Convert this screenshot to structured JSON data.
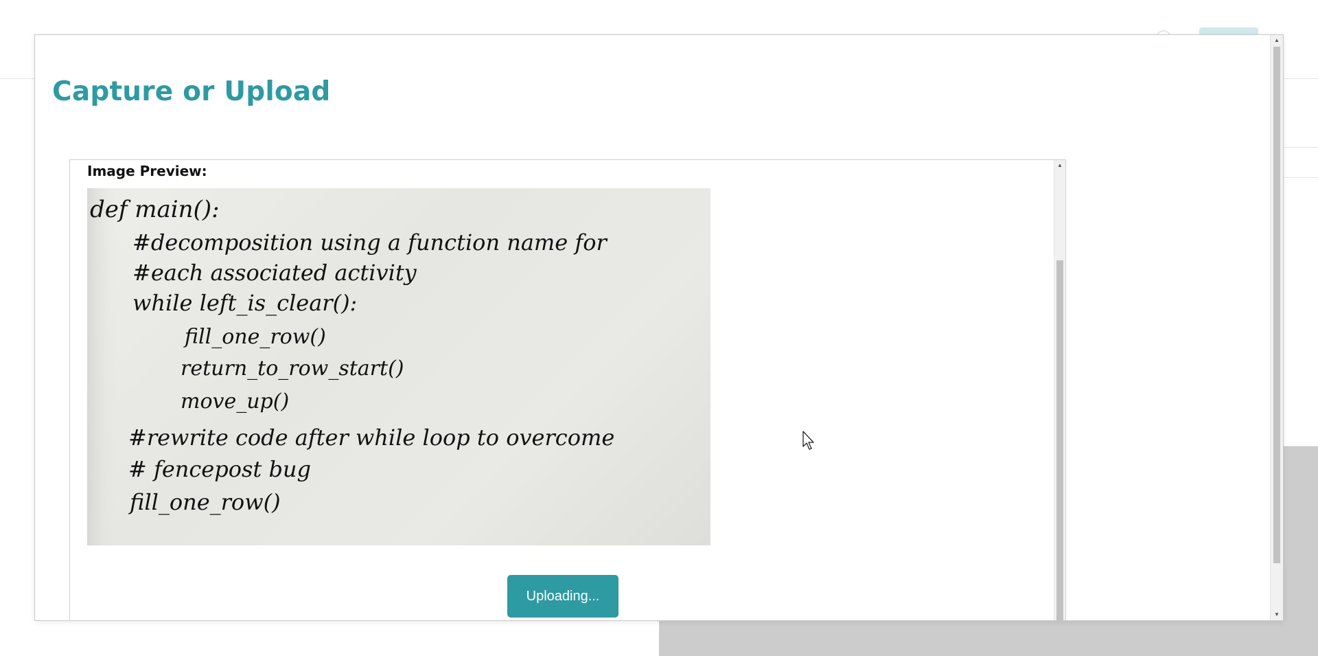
{
  "modal": {
    "title": "Capture or Upload"
  },
  "preview": {
    "label": "Image Preview:",
    "image_alt": "Handwritten Python code on paper",
    "code_lines": [
      "def main():",
      "#decomposition using a function name for",
      "#each associated activity",
      "while left_is_clear():",
      "fill_one_row()",
      "return_to_row_start()",
      "move_up()",
      "#rewrite code after while loop to overcome",
      "# fencepost bug",
      "fill_one_row()"
    ]
  },
  "upload_button": {
    "label": "Uploading..."
  },
  "colors": {
    "accent": "#2e9aa2",
    "overlay_gray": "#cccccc"
  },
  "icons": {
    "cursor": "mouse-pointer-icon",
    "scroll_up": "scroll-up-arrow-icon",
    "scroll_down": "scroll-down-arrow-icon"
  }
}
